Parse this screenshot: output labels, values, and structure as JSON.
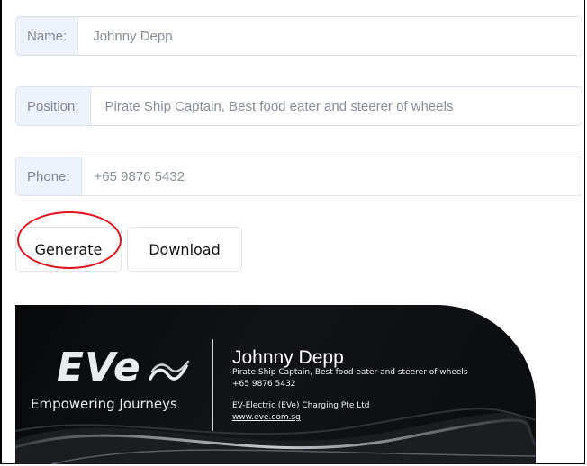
{
  "form": {
    "name": {
      "label": "Name:",
      "value": "Johnny Depp"
    },
    "position": {
      "label": "Position:",
      "value": "Pirate Ship Captain, Best food eater and steerer of wheels"
    },
    "phone": {
      "label": "Phone:",
      "value": "+65 9876 5432"
    }
  },
  "actions": {
    "generate_label": "Generate",
    "download_label": "Download"
  },
  "card": {
    "logo_text": "EVe",
    "logo_icon": "wave-icon",
    "tagline": "Empowering Journeys",
    "name": "Johnny Depp",
    "position": "Pirate Ship Captain, Best food eater and steerer of wheels",
    "phone": "+65 9876 5432",
    "company": "EV-Electric (EVe) Charging Pte Ltd",
    "website": "www.eve.com.sg"
  },
  "colors": {
    "annotation_circle": "#e0141b",
    "card_background": "#0b0c0f",
    "input_label_bg": "#eef3fb"
  }
}
